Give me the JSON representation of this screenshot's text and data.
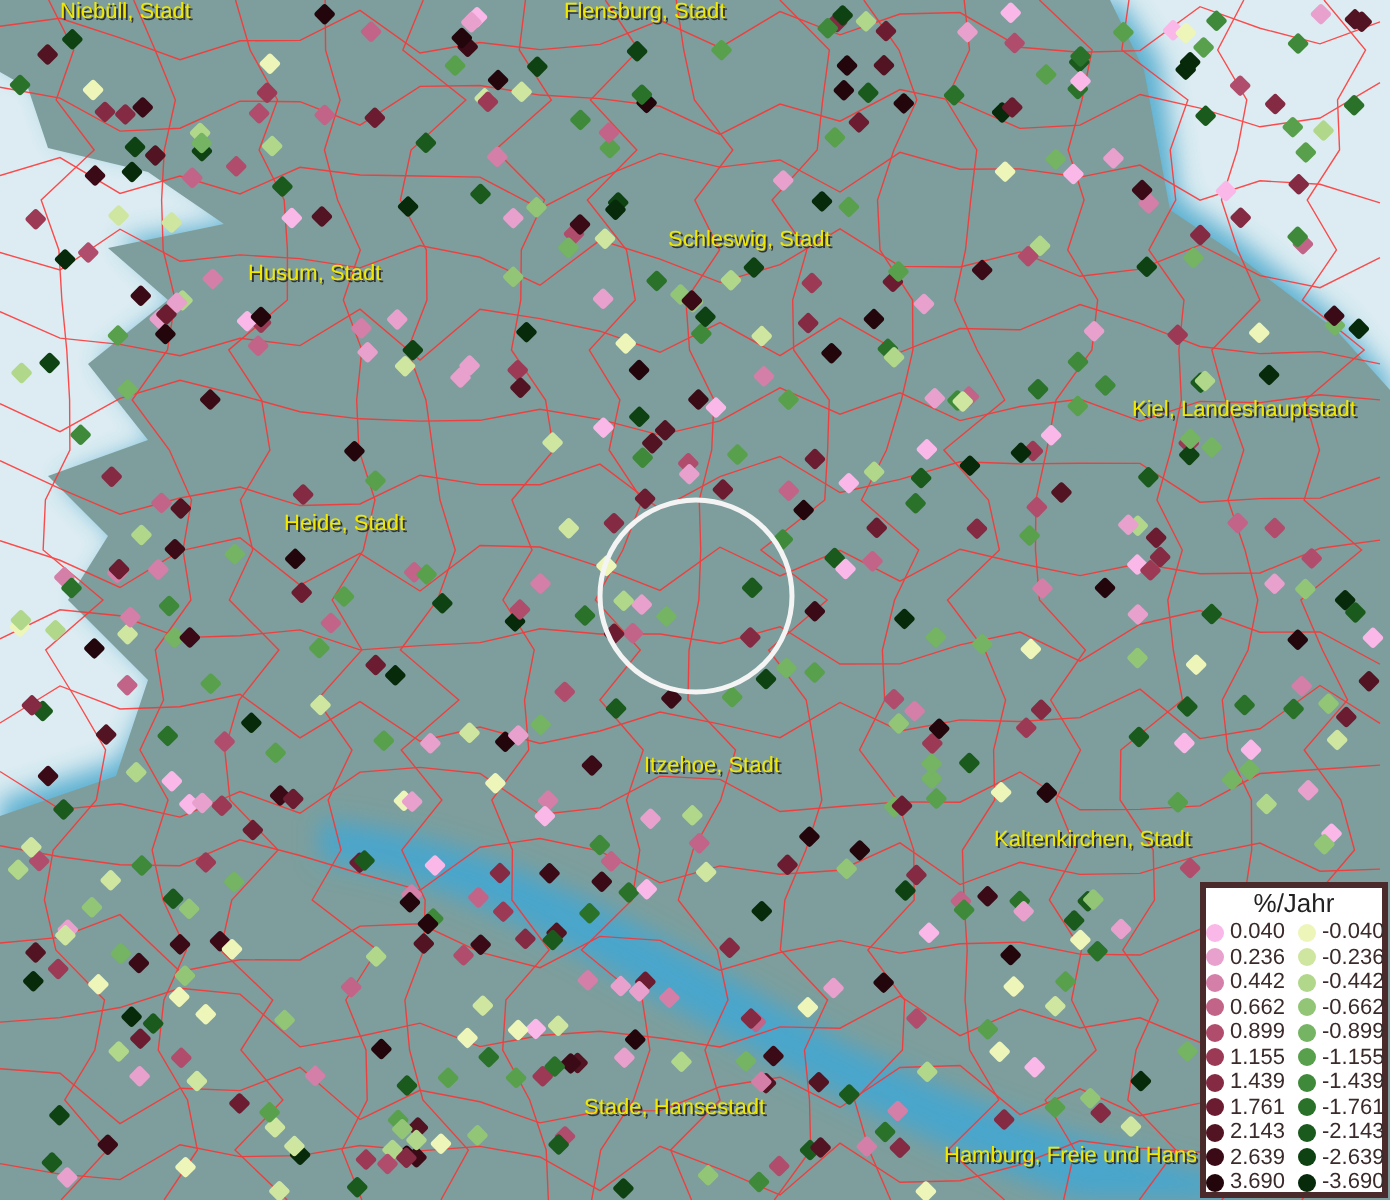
{
  "map": {
    "places": [
      {
        "name": "Niebüll, Stadt"
      },
      {
        "name": "Flensburg, Stadt"
      },
      {
        "name": "Husum, Stadt"
      },
      {
        "name": "Schleswig, Stadt"
      },
      {
        "name": "Kiel, Landeshauptstadt"
      },
      {
        "name": "Heide, Stadt"
      },
      {
        "name": "Itzehoe, Stadt"
      },
      {
        "name": "Kaltenkirchen, Stadt"
      },
      {
        "name": "Stade, Hansestadt"
      },
      {
        "name": "Hamburg, Freie und Hans"
      }
    ]
  },
  "legend": {
    "title": "%/Jahr",
    "entries": [
      {
        "label": "0.040",
        "color": "#f9b8e8"
      },
      {
        "label": "-0.040",
        "color": "#eef5b8"
      },
      {
        "label": "0.236",
        "color": "#e8a0cc"
      },
      {
        "label": "-0.236",
        "color": "#cfe6a0"
      },
      {
        "label": "0.442",
        "color": "#d47fa8"
      },
      {
        "label": "-0.442",
        "color": "#b0d78a"
      },
      {
        "label": "0.662",
        "color": "#c26487"
      },
      {
        "label": "-0.662",
        "color": "#92c676"
      },
      {
        "label": "0.899",
        "color": "#b04d6c"
      },
      {
        "label": "-0.899",
        "color": "#74b462"
      },
      {
        "label": "1.155",
        "color": "#9c3a56"
      },
      {
        "label": "-1.155",
        "color": "#58a04c"
      },
      {
        "label": "1.439",
        "color": "#842a43"
      },
      {
        "label": "-1.439",
        "color": "#3f8a3a"
      },
      {
        "label": "1.761",
        "color": "#6c1c30"
      },
      {
        "label": "-1.761",
        "color": "#2a722a"
      },
      {
        "label": "2.143",
        "color": "#521322"
      },
      {
        "label": "-2.143",
        "color": "#1a5a1c"
      },
      {
        "label": "2.639",
        "color": "#3a0b16"
      },
      {
        "label": "-2.639",
        "color": "#0e4212"
      },
      {
        "label": "3.690",
        "color": "#22060c"
      },
      {
        "label": "-3.690",
        "color": "#062a0a"
      }
    ]
  }
}
